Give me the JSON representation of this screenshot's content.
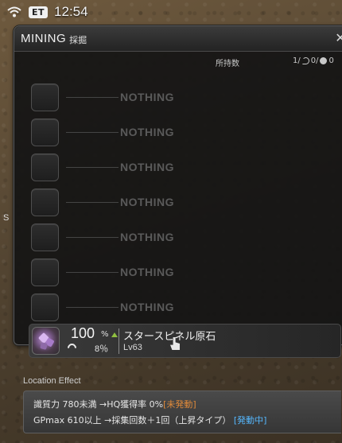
{
  "hud": {
    "et_label": "ET",
    "time": "12:54",
    "side_letter": "S"
  },
  "window": {
    "title": "MINING",
    "title_sub": "採掘",
    "owned_label": "所持数",
    "owned_count": "1/",
    "owned_hq": "0/",
    "owned_collectable": "0"
  },
  "slots": [
    {
      "text": "NOTHING"
    },
    {
      "text": "NOTHING"
    },
    {
      "text": "NOTHING"
    },
    {
      "text": "NOTHING"
    },
    {
      "text": "NOTHING"
    },
    {
      "text": "NOTHING"
    },
    {
      "text": "NOTHING"
    }
  ],
  "item": {
    "chance": "100",
    "chance_unit": "%",
    "hq_chance": "8％",
    "name": "スタースピネル原石",
    "level": "Lv63"
  },
  "location_effect": {
    "label": "Location Effect",
    "line1_text": "識質力 780未満 →HQ獲得率 0%",
    "line1_status": "[未発動]",
    "line2_text": "GPmax 610以上 →採集回数＋1回（上昇タイプ）",
    "line2_status": "[発動中]"
  },
  "colors": {
    "status_inactive": "#e08a3a",
    "status_active": "#55b8ff",
    "hq_arrow": "#8fc040"
  }
}
